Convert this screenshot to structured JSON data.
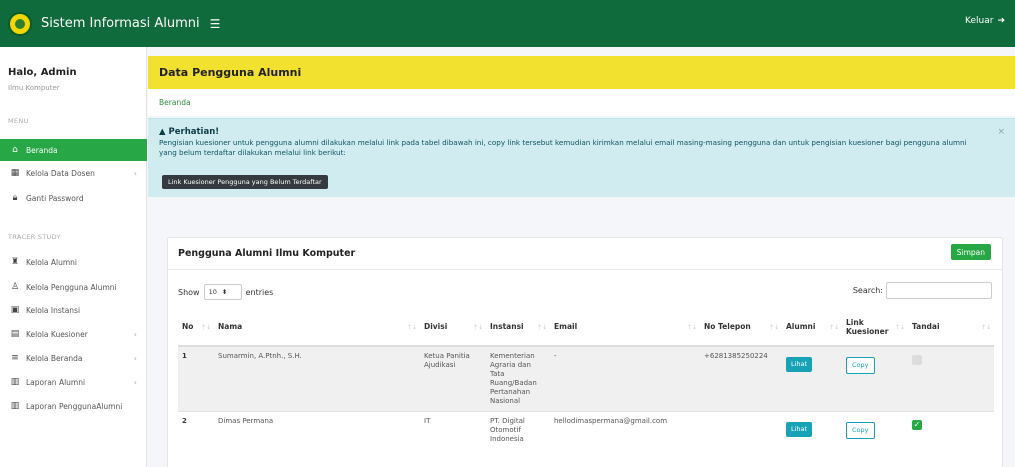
{
  "header": {
    "app_title": "Sistem Informasi Alumni",
    "logout_label": "Keluar"
  },
  "sidebar": {
    "user_name": "Halo, Admin",
    "user_role": "Ilmu Komputer",
    "section_menu": "MENU",
    "section_tracer": "TRACER STUDY",
    "items": [
      {
        "label": "Beranda",
        "icon": "home-icon"
      },
      {
        "label": "Kelola Data Dosen",
        "icon": "table-icon"
      },
      {
        "label": "Ganti Password",
        "icon": "lock-icon"
      },
      {
        "label": "Kelola Alumni",
        "icon": "graduate-icon"
      },
      {
        "label": "Kelola Pengguna Alumni",
        "icon": "user-icon"
      },
      {
        "label": "Kelola Instansi",
        "icon": "building-icon"
      },
      {
        "label": "Kelola Kuesioner",
        "icon": "clipboard-icon"
      },
      {
        "label": "Kelola Beranda",
        "icon": "list-icon"
      },
      {
        "label": "Laporan Alumni",
        "icon": "chart-icon"
      },
      {
        "label": "Laporan PenggunaAlumni",
        "icon": "chart-icon"
      }
    ]
  },
  "page": {
    "title": "Data Pengguna Alumni",
    "breadcrumb": "Beranda"
  },
  "alert": {
    "title": "Perhatian!",
    "text": "Pengisian kuesioner untuk pengguna alumni dilakukan melalui link pada tabel dibawah ini, copy link tersebut kemudian kirimkan melalui email masing-masing pengguna dan untuk pengisian kuesioner bagi pengguna alumni yang belum terdaftar dilakukan melalui link berikut:",
    "button_label": "Link Kuesioner Pengguna yang Belum Terdaftar"
  },
  "card": {
    "title": "Pengguna Alumni Ilmu Komputer",
    "save_label": "Simpan",
    "show_label": "Show",
    "entries_value": "10",
    "entries_label": "entries",
    "search_label": "Search:",
    "columns": [
      "No",
      "Nama",
      "Divisi",
      "Instansi",
      "Email",
      "No Telepon",
      "Alumni",
      "Link Kuesioner",
      "Tandai"
    ],
    "rows": [
      {
        "no": "1",
        "nama": "Sumarmin, A.Ptnh., S.H.",
        "divisi": "Ketua Panitia Ajudikasi",
        "instansi": "Kementerian Agraria dan Tata Ruang/Badan Pertanahan Nasional",
        "email": "-",
        "telepon": "+6281385250224",
        "alumni": "Lihat",
        "link": "Copy",
        "tandai": false
      },
      {
        "no": "2",
        "nama": "Dimas Permana",
        "divisi": "IT",
        "instansi": "PT. Digital Otomotif Indonesia",
        "email": "hellodimaspermana@gmail.com",
        "telepon": "",
        "alumni": "Lihat",
        "link": "Copy",
        "tandai": true
      }
    ]
  }
}
